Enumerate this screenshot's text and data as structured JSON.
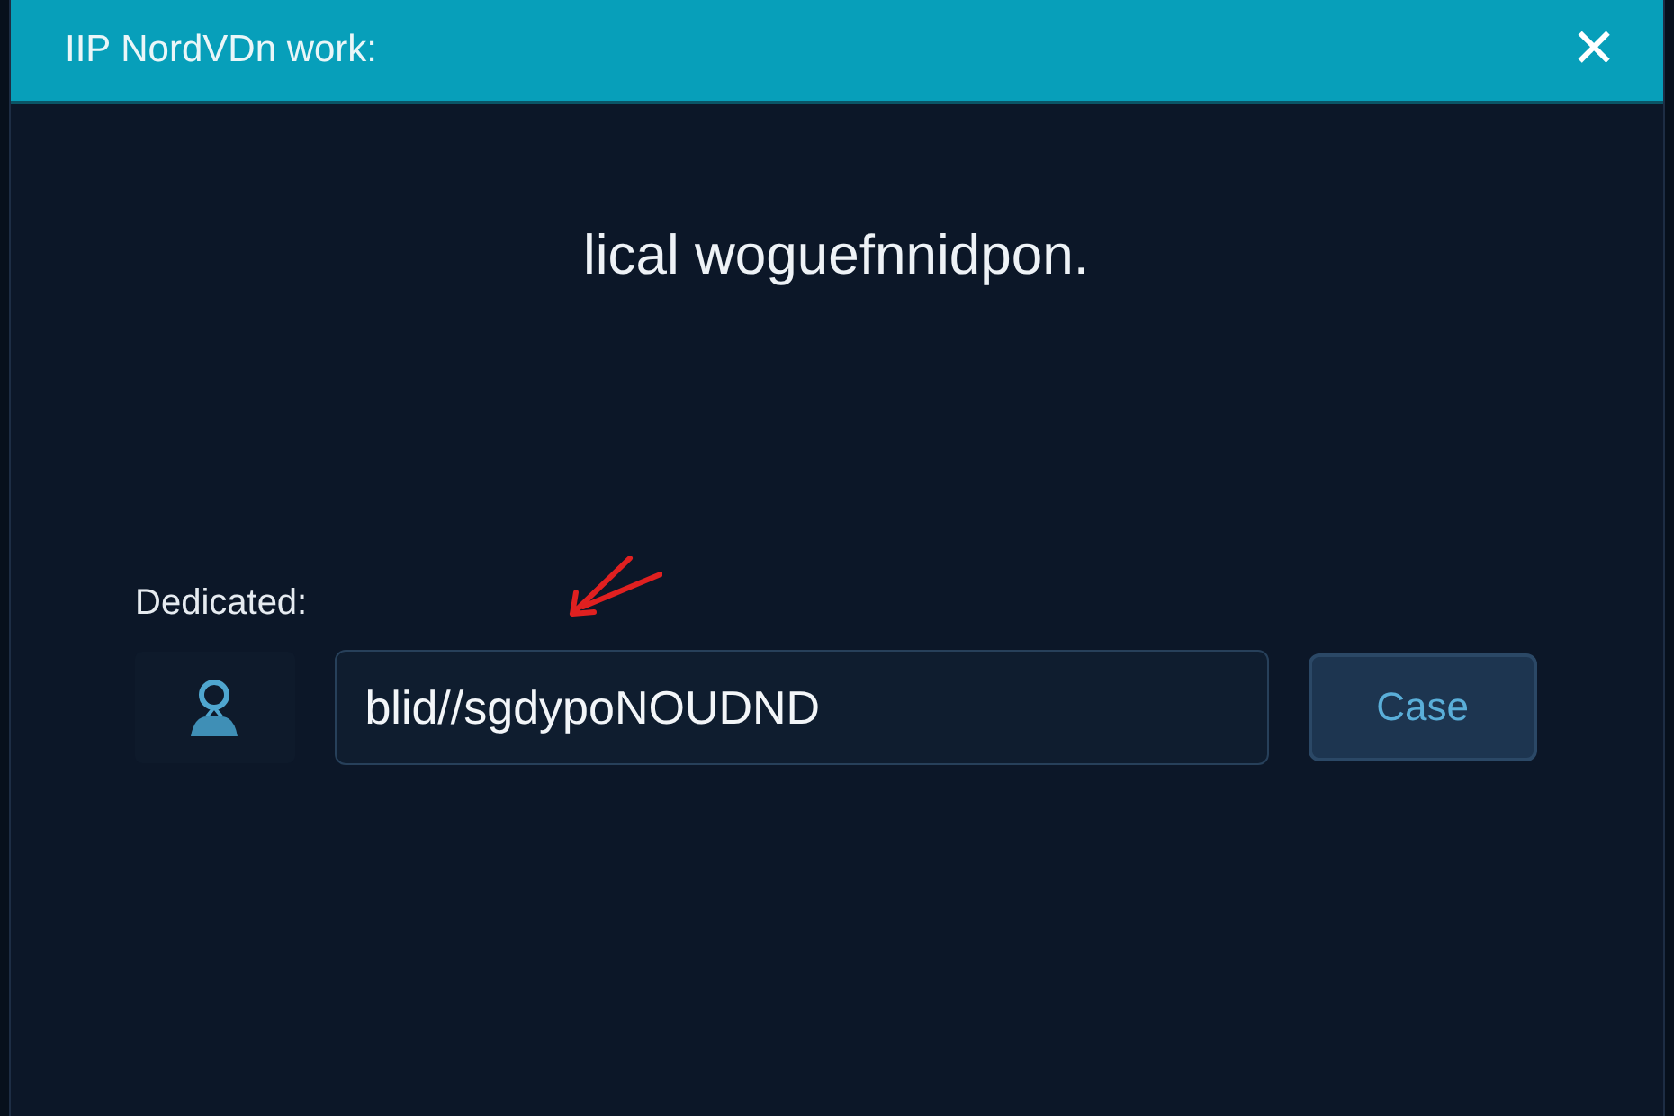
{
  "window": {
    "title": "IIP NordVDn work:",
    "close": "✕"
  },
  "message": "lical woguefnnidpon.",
  "dedicated": {
    "label": "Dedicated:",
    "value": "blid//sgdypoNOUDND",
    "button": "Case"
  }
}
